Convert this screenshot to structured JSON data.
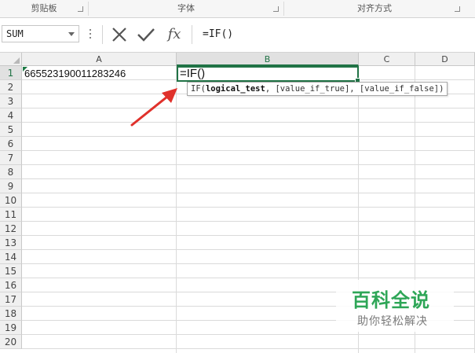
{
  "ribbon": {
    "groups": [
      {
        "label": "剪贴板"
      },
      {
        "label": "字体"
      },
      {
        "label": "对齐方式"
      }
    ]
  },
  "formula_bar": {
    "name_box": "SUM",
    "cancel_icon": "close-icon",
    "enter_icon": "check-icon",
    "fx_label": "fx",
    "formula": "=IF()"
  },
  "sheet": {
    "columns": [
      "A",
      "B",
      "C",
      "D"
    ],
    "rows": [
      "1",
      "2",
      "3",
      "4",
      "5",
      "6",
      "7",
      "8",
      "9",
      "10",
      "11",
      "12",
      "13",
      "14",
      "15",
      "16",
      "17",
      "18",
      "19",
      "20"
    ],
    "cell_a1": "665523190011283246",
    "active_cell_text": "=IF()",
    "selected_column": "B",
    "selected_row": "1"
  },
  "tooltip": {
    "prefix": "IF(",
    "arg1": "logical_test",
    "rest": ", [value_if_true], [value_if_false])"
  },
  "watermark": {
    "title": "百科全说",
    "subtitle": "助你轻松解决"
  },
  "colors": {
    "accent_green": "#217346",
    "arrow_red": "#e0312b",
    "watermark_green": "#2ea657"
  }
}
